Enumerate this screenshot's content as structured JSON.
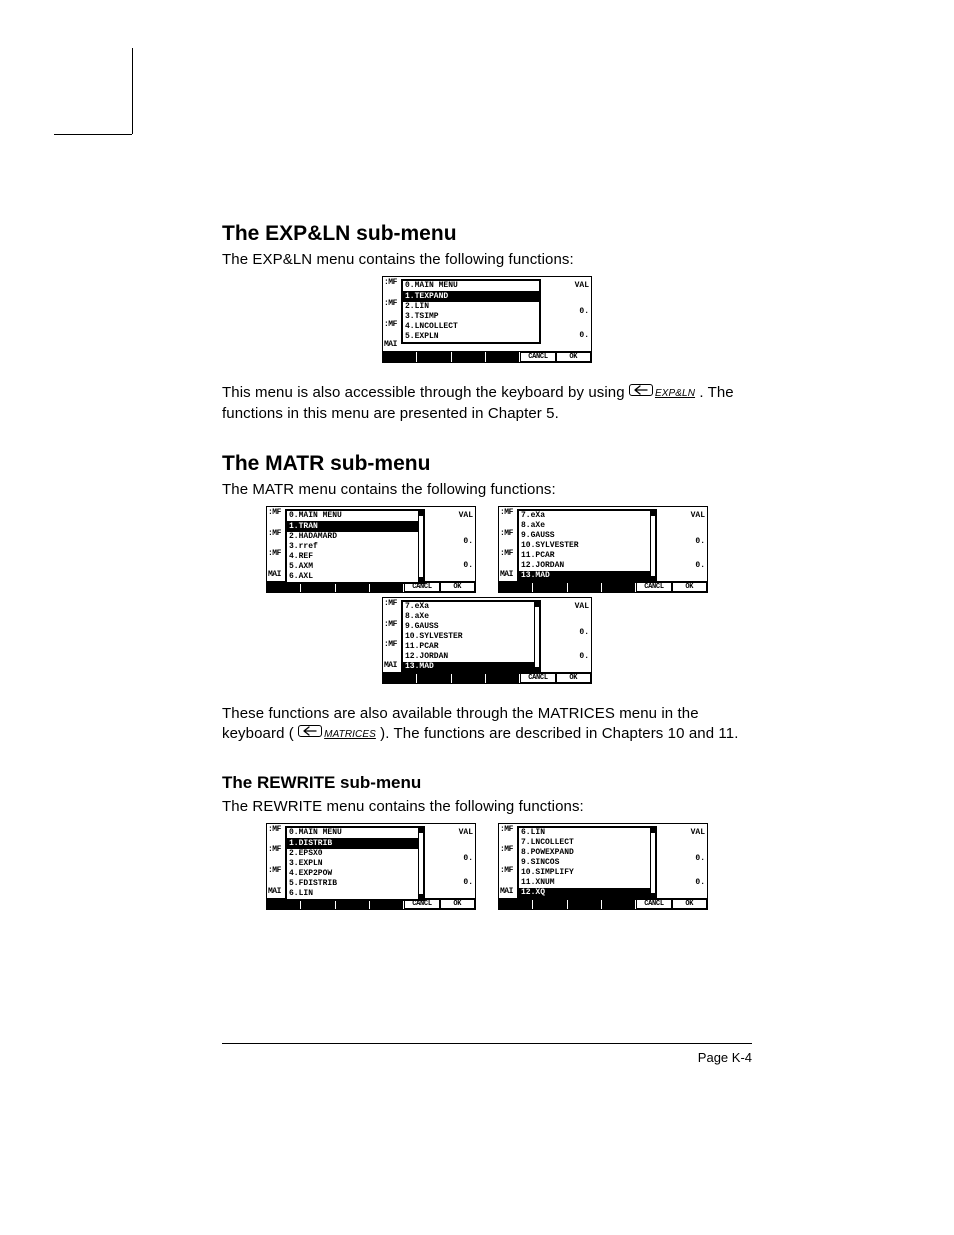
{
  "crop": {},
  "section1": {
    "heading": "The EXP&LN sub-menu",
    "intro": "The EXP&LN menu contains the following functions:",
    "after1": "This menu is also accessible through the keyboard by using ",
    "after2": " .  The functions in this menu are presented in Chapter 5.",
    "shift_label": "EXP&LN"
  },
  "section2": {
    "heading": "The MATR sub-menu",
    "intro": "The MATR menu contains the following functions:",
    "after1": "These functions are also available through the MATRICES menu in the keyboard (",
    "after2": ").  The functions are described in Chapters 10 and 11.",
    "shift_label": "MATRICES"
  },
  "section3": {
    "heading": "The REWRITE sub-menu",
    "intro": "The REWRITE menu contains the following functions:"
  },
  "ui": {
    "left_rows": [
      ":MF",
      ":MF",
      ":MF",
      "MAI"
    ],
    "val": "VAL",
    "zero": "0.",
    "cancl": "CANCL",
    "ok": "OK"
  },
  "expln_menu": {
    "items": [
      "0.MAIN MENU",
      "1.TEXPAND",
      "2.LIN",
      "3.TSIMP",
      "4.LNCOLLECT",
      "5.EXPLN"
    ],
    "hl": 1
  },
  "matr_menu_a": {
    "items": [
      "0.MAIN MENU",
      "1.TRAN",
      "2.HADAMARD",
      "3.rref",
      "4.REF",
      "5.AXM",
      "6.AXL"
    ],
    "hl": 1
  },
  "matr_menu_b": {
    "items": [
      "7.eXa",
      "8.aXe",
      "9.GAUSS",
      "10.SYLVESTER",
      "11.PCAR",
      "12.JORDAN",
      "13.MAD"
    ],
    "hl": 6
  },
  "matr_menu_c": {
    "items": [
      "7.eXa",
      "8.aXe",
      "9.GAUSS",
      "10.SYLVESTER",
      "11.PCAR",
      "12.JORDAN",
      "13.MAD"
    ],
    "hl": 6
  },
  "rewrite_menu_a": {
    "items": [
      "0.MAIN MENU",
      "1.DISTRIB",
      "2.EPSX0",
      "3.EXPLN",
      "4.EXP2POW",
      "5.FDISTRIB",
      "6.LIN"
    ],
    "hl": 1
  },
  "rewrite_menu_b": {
    "items": [
      "6.LIN",
      "7.LNCOLLECT",
      "8.POWEXPAND",
      "9.SINCOS",
      "10.SIMPLIFY",
      "11.XNUM",
      "12.XQ"
    ],
    "hl": 6
  },
  "footer": {
    "page": "Page K-4"
  }
}
